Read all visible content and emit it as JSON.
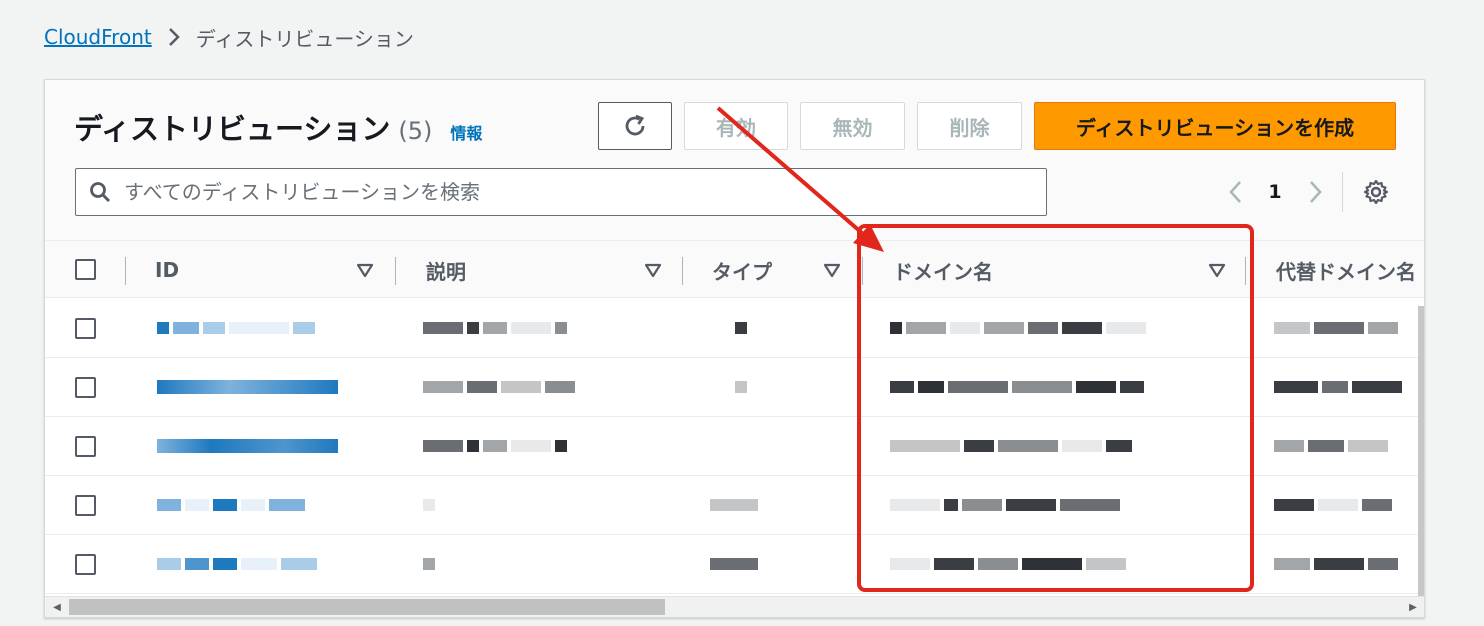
{
  "breadcrumb": {
    "root": "CloudFront",
    "current": "ディストリビューション"
  },
  "header": {
    "title": "ディストリビューション",
    "count": "(5)",
    "info_link": "情報"
  },
  "toolbar": {
    "refresh_icon": "refresh-icon",
    "enable_label": "有効",
    "disable_label": "無効",
    "delete_label": "削除",
    "create_label": "ディストリビューションを作成"
  },
  "search": {
    "placeholder": "すべてのディストリビューションを検索",
    "value": ""
  },
  "pagination": {
    "current_page": "1"
  },
  "table": {
    "columns": [
      "ID",
      "説明",
      "タイプ",
      "ドメイン名",
      "代替ドメイン名"
    ],
    "row_count": 5
  },
  "colors": {
    "accent_link": "#0073bb",
    "primary_button": "#ff9900",
    "highlight": "#e1261c"
  }
}
